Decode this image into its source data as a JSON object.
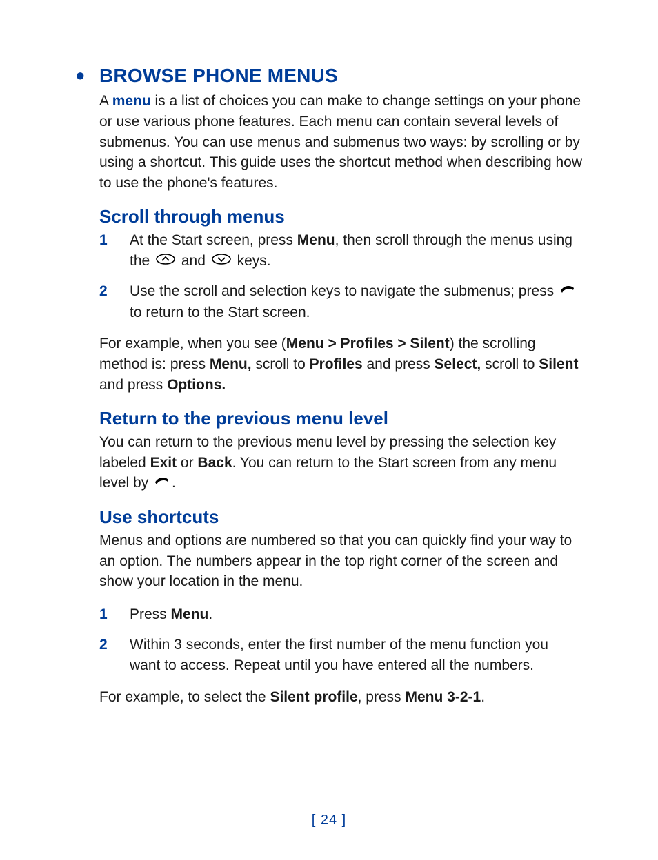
{
  "heading": "BROWSE PHONE MENUS",
  "intro": {
    "pre": "A ",
    "term": "menu",
    "post": " is a list of choices you can make to change settings on your phone or use various phone features. Each menu can contain several levels of submenus. You can use menus and submenus two ways: by scrolling or by using a shortcut. This guide uses the shortcut method when describing how to use the phone's features."
  },
  "section1": {
    "title": "Scroll through menus",
    "steps": [
      {
        "num": "1",
        "pre": "At the Start screen, press ",
        "b1": "Menu",
        "mid1": ", then scroll through the menus using the ",
        "mid2": " and ",
        "post": " keys."
      },
      {
        "num": "2",
        "pre": "Use the scroll and selection keys to navigate the submenus; press ",
        "post": " to return to the Start screen."
      }
    ],
    "example": {
      "p1": "For example, when you see (",
      "b1": "Menu > Profiles > Silent",
      "p2": ") the scrolling method is: press ",
      "b2": "Menu,",
      "p3": " scroll to ",
      "b3": "Profiles",
      "p4": " and press ",
      "b4": "Select,",
      "p5": " scroll to ",
      "b5": "Silent",
      "p6": " and press ",
      "b6": "Options."
    }
  },
  "section2": {
    "title": "Return to the previous menu level",
    "body": {
      "p1": "You can return to the previous menu level by pressing the selection key labeled ",
      "b1": "Exit",
      "p2": " or ",
      "b2": "Back",
      "p3": ". You can return to the Start screen from any menu level by ",
      "p4": "."
    }
  },
  "section3": {
    "title": "Use shortcuts",
    "body": "Menus and options are numbered so that you can quickly find your way to an option. The numbers appear in the top right corner of the screen and show your location in the menu.",
    "steps": [
      {
        "num": "1",
        "pre": "Press ",
        "b1": "Menu",
        "post": "."
      },
      {
        "num": "2",
        "text": "Within 3 seconds, enter the first number of the menu function you want to access. Repeat until you have entered all the numbers."
      }
    ],
    "example": {
      "p1": "For example, to select the ",
      "b1": "Silent profile",
      "p2": ", press ",
      "b2": "Menu 3-2-1",
      "p3": "."
    }
  },
  "page_number": "[ 24 ]"
}
